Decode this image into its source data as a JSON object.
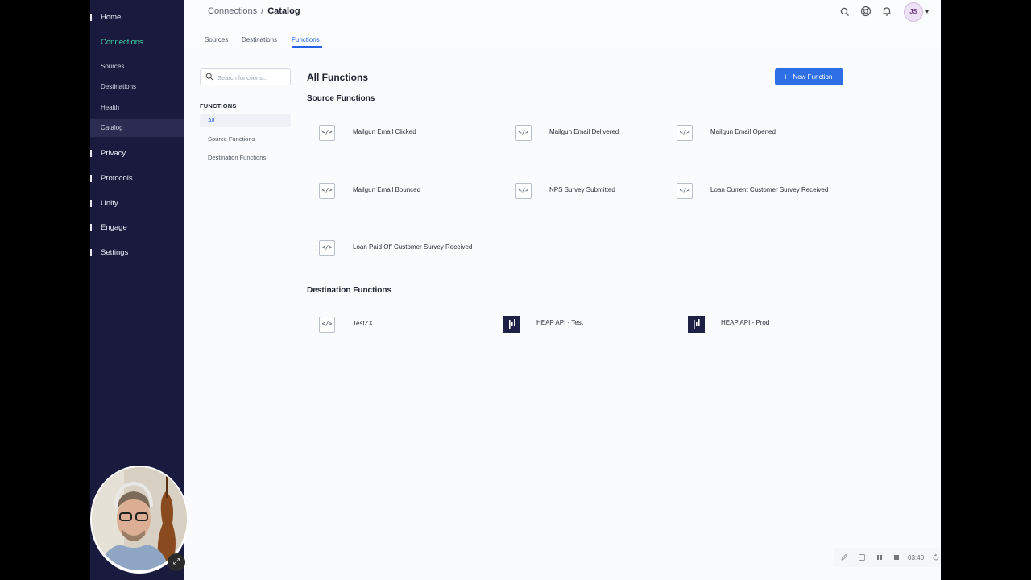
{
  "sidebar": {
    "items": [
      {
        "label": "Home"
      },
      {
        "label": "Connections"
      },
      {
        "label": "Sources"
      },
      {
        "label": "Destinations"
      },
      {
        "label": "Health"
      },
      {
        "label": "Catalog"
      },
      {
        "label": "Privacy"
      },
      {
        "label": "Protocols"
      },
      {
        "label": "Unify"
      },
      {
        "label": "Engage"
      },
      {
        "label": "Settings"
      }
    ]
  },
  "header": {
    "breadcrumb": {
      "parent": "Connections",
      "separator": "/",
      "current": "Catalog"
    },
    "tabs": [
      {
        "label": "Sources"
      },
      {
        "label": "Destinations"
      },
      {
        "label": "Functions"
      }
    ],
    "avatar_initials": "JS"
  },
  "left_panel": {
    "search_placeholder": "Search functions...",
    "heading": "FUNCTIONS",
    "filters": [
      {
        "label": "All"
      },
      {
        "label": "Source Functions"
      },
      {
        "label": "Destination Functions"
      }
    ]
  },
  "main": {
    "title": "All Functions",
    "new_button": "New Function",
    "source_section": {
      "title": "Source Functions",
      "items": [
        {
          "label": "Mailgun Email Clicked"
        },
        {
          "label": "Mailgun Email Delivered"
        },
        {
          "label": "Mailgun Email Opened"
        },
        {
          "label": "Mailgun Email Bounced"
        },
        {
          "label": "NPS Survey Submitted"
        },
        {
          "label": "Loan Current Customer Survey Received"
        },
        {
          "label": "Loan Paid Off Customer Survey Received"
        }
      ]
    },
    "destination_section": {
      "title": "Destination Functions",
      "items": [
        {
          "label": "TestZX"
        },
        {
          "label": "HEAP API - Test"
        },
        {
          "label": "HEAP API - Prod"
        }
      ]
    }
  },
  "recording": {
    "time": "03:40"
  },
  "icons": {
    "code": "</>"
  },
  "colors": {
    "sidebar_bg": "#1a1a3e",
    "accent_green": "#3fd5a4",
    "primary_blue": "#2f6fe6"
  }
}
